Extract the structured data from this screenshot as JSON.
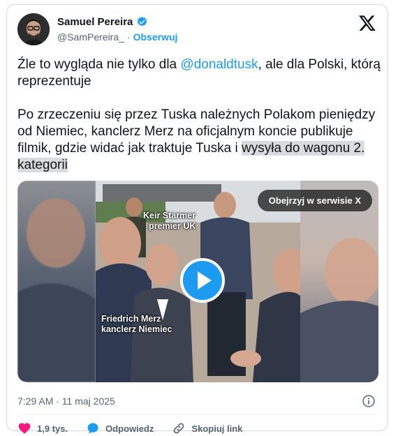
{
  "author": {
    "name": "Samuel Pereira",
    "handle": "@SamPereira_",
    "separator": "·",
    "follow_label": "Obserwuj",
    "verified_icon": "verified-badge-icon"
  },
  "tweet": {
    "line1_prefix": "Źle to wygląda nie tylko dla ",
    "mention": "@donaldtusk",
    "line1_suffix": ", ale dla Polski, którą reprezentuje",
    "para2_main": "Po zrzeczeniu się przez Tuska należnych Polakom pieniędzy od Niemiec, kanclerz Merz na oficjalnym koncie publikuje filmik, gdzie widać jak traktuje Tuska i ",
    "para2_highlight": "wysyła do wagonu 2. kategorii"
  },
  "media": {
    "view_on_x": "Obejrzyj w serwisie X",
    "caption1_line1": "Keir Starmer",
    "caption1_line2": "premier UK",
    "caption2_line1": "Friedrich Merz",
    "caption2_line2": "kanclerz Niemiec"
  },
  "meta": {
    "timestamp": "7:29 AM · 11 maj 2025"
  },
  "actions": {
    "likes": "1,9 tys.",
    "reply": "Odpowiedz",
    "copy_link": "Skopiuj link"
  },
  "colors": {
    "accent": "#1d9bf0",
    "like": "#f91880",
    "muted": "#536471"
  }
}
